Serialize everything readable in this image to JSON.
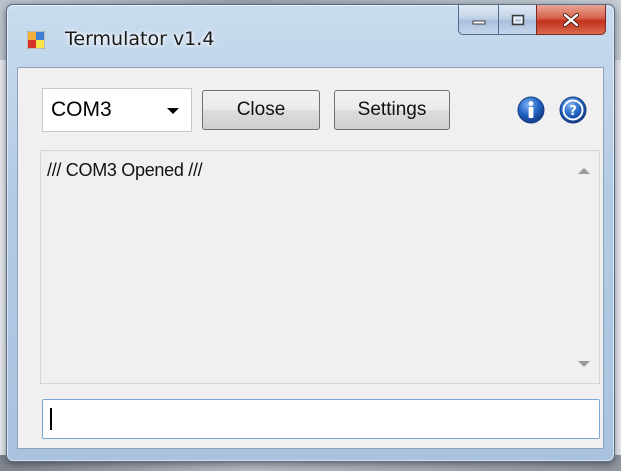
{
  "window": {
    "title": "Termulator v1.4",
    "caption_buttons": [
      "minimize-icon",
      "maximize-icon",
      "close-icon"
    ],
    "close_color": "#c93a22"
  },
  "toolbar": {
    "port": {
      "selected": "COM3"
    },
    "close_label": "Close",
    "settings_label": "Settings",
    "info_icon": "info-icon",
    "help_icon": "help-icon",
    "icon_color": "#1f5fbf"
  },
  "log": {
    "text": "/// COM3 Opened ///"
  },
  "input": {
    "value": ""
  }
}
